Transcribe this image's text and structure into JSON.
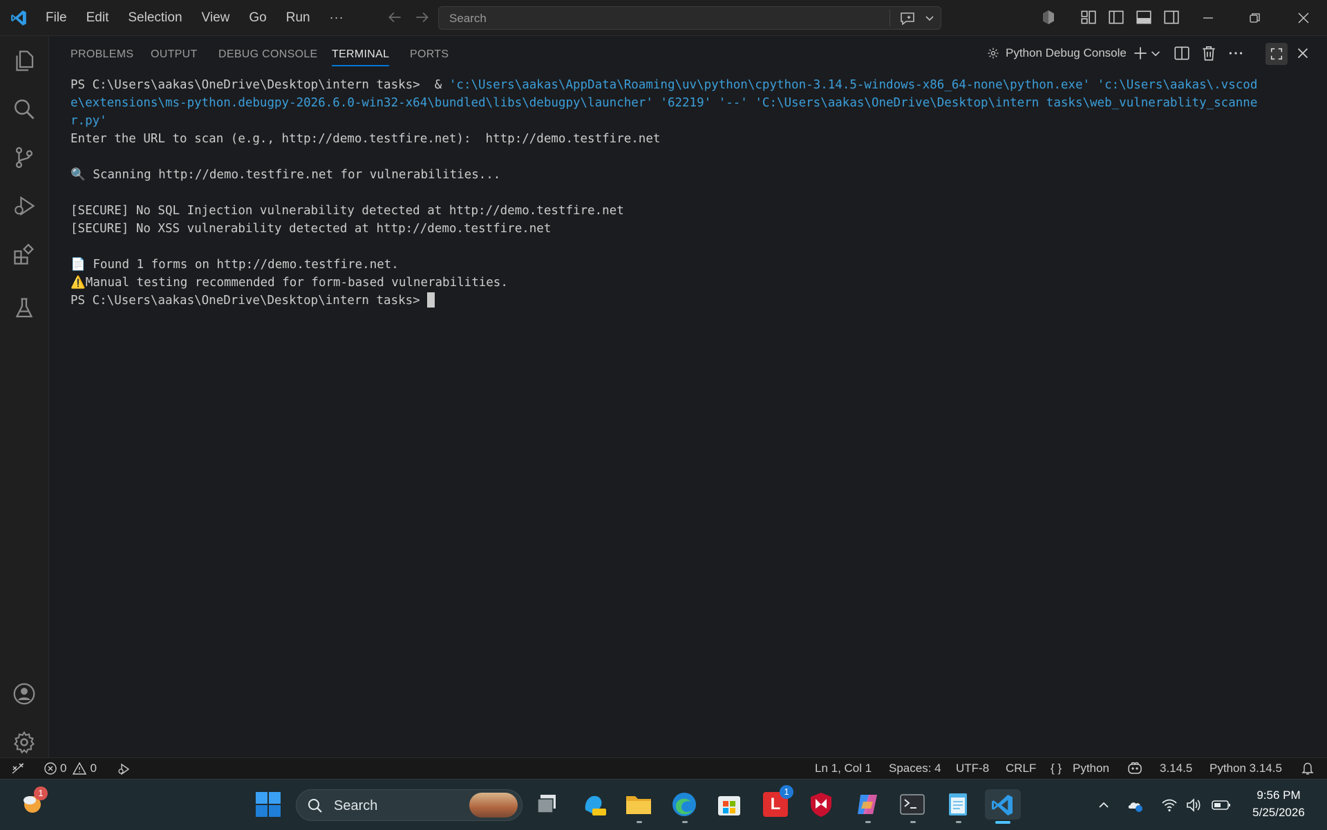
{
  "titlebar": {
    "menu": [
      "File",
      "Edit",
      "Selection",
      "View",
      "Go",
      "Run"
    ],
    "menu_more": "···",
    "search_placeholder": "Search"
  },
  "panel": {
    "tabs": [
      {
        "label": "PROBLEMS",
        "active": false
      },
      {
        "label": "OUTPUT",
        "active": false
      },
      {
        "label": "DEBUG CONSOLE",
        "active": false
      },
      {
        "label": "TERMINAL",
        "active": true
      },
      {
        "label": "PORTS",
        "active": false
      }
    ],
    "terminal_name": "Python Debug Console"
  },
  "terminal": {
    "line1_prompt": "PS C:\\Users\\aakas\\OneDrive\\Desktop\\intern tasks>  & ",
    "line1_cmd": "'c:\\Users\\aakas\\AppData\\Roaming\\uv\\python\\cpython-3.14.5-windows-x86_64-none\\python.exe' 'c:\\Users\\aakas\\.vscod",
    "line2_cmd": "e\\extensions\\ms-python.debugpy-2026.6.0-win32-x64\\bundled\\libs\\debugpy\\launcher' '62219' '--' 'C:\\Users\\aakas\\OneDrive\\Desktop\\intern tasks\\web_vulnerablity_scanne",
    "line3_cmd": "r.py'",
    "line4": "Enter the URL to scan (e.g., http://demo.testfire.net):  http://demo.testfire.net",
    "line6": "🔍 Scanning http://demo.testfire.net for vulnerabilities...",
    "line8": "[SECURE] No SQL Injection vulnerability detected at http://demo.testfire.net",
    "line9": "[SECURE] No XSS vulnerability detected at http://demo.testfire.net",
    "line11": "📄 Found 1 forms on http://demo.testfire.net.",
    "line12": "⚠️Manual testing recommended for form-based vulnerabilities.",
    "line13": "PS C:\\Users\\aakas\\OneDrive\\Desktop\\intern tasks> "
  },
  "statusbar": {
    "errors": "0",
    "warnings": "0",
    "position": "Ln 1, Col 1",
    "spaces": "Spaces: 4",
    "encoding": "UTF-8",
    "eol": "CRLF",
    "language_braces": "{ }",
    "language": "Python",
    "python_version": "3.14.5",
    "interpreter": "Python 3.14.5"
  },
  "taskbar": {
    "search_label": "Search",
    "weather_badge": "1",
    "app_badge": "1",
    "app_letter": "L",
    "time": "9:56 PM",
    "date": "5/25/2026"
  },
  "colors": {
    "accent": "#0078d4",
    "command_text": "#3b9fdb",
    "background": "#1b1c1f"
  }
}
